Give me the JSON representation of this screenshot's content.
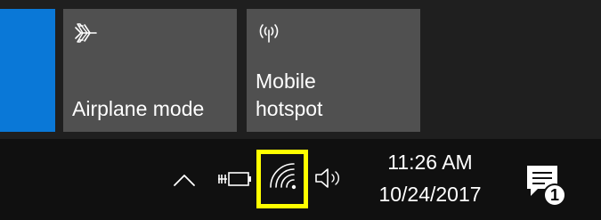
{
  "action_center": {
    "tiles": [
      {
        "label": "Airplane mode",
        "icon": "airplane-icon"
      },
      {
        "label": "Mobile\nhotspot",
        "icon": "hotspot-icon"
      }
    ],
    "accent_color": "#0a78d7",
    "tile_color": "#505050"
  },
  "taskbar": {
    "tray": {
      "show_hidden_icons": "chevron-up-icon",
      "power": "battery-plug-icon",
      "network": "wifi-icon",
      "volume": "speaker-icon",
      "network_highlight_color": "#ffff00"
    },
    "clock": {
      "time": "11:26 AM",
      "date": "10/24/2017"
    },
    "notifications": {
      "icon": "notification-icon",
      "count": "1"
    }
  }
}
